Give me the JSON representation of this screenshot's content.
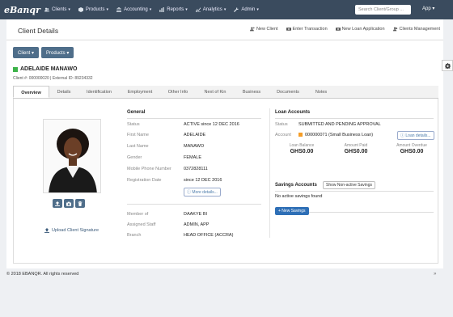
{
  "nav": {
    "brand": "eBanqr",
    "items": [
      {
        "label": "Clients",
        "icon": "users-icon"
      },
      {
        "label": "Products",
        "icon": "box-icon"
      },
      {
        "label": "Accounting",
        "icon": "bank-icon"
      },
      {
        "label": "Reports",
        "icon": "bar-chart-icon"
      },
      {
        "label": "Analytics",
        "icon": "line-chart-icon"
      },
      {
        "label": "Admin",
        "icon": "wrench-icon"
      }
    ],
    "search_placeholder": "Search Client/Group ...",
    "app_user": "App"
  },
  "header": {
    "title": "Client Details",
    "links": [
      {
        "label": "New Client",
        "icon": "user-plus-icon"
      },
      {
        "label": "Enter Transaction",
        "icon": "money-icon"
      },
      {
        "label": "New Loan Application",
        "icon": "money-icon"
      },
      {
        "label": "Clients Management",
        "icon": "users-icon"
      }
    ]
  },
  "toolbar": {
    "client_label": "Client",
    "products_label": "Products"
  },
  "client": {
    "name": "ADELAIDE MANAWO",
    "ids": "Client #: 000000020 | External ID: 89234332",
    "status_color": "#3db34a"
  },
  "tabs": [
    "Overview",
    "Details",
    "Identification",
    "Employment",
    "Other Info",
    "Next of Kin",
    "Business",
    "Documents",
    "Notes"
  ],
  "photo": {
    "upload_signature_label": "Upload Client Signature"
  },
  "general": {
    "title": "General",
    "rows": [
      {
        "label": "Status",
        "value": "ACTIVE since 12 DEC 2016"
      },
      {
        "label": "First Name",
        "value": "ADELAIDE"
      },
      {
        "label": "Last Name",
        "value": "MANAWO"
      },
      {
        "label": "Gender",
        "value": "FEMALE"
      },
      {
        "label": "Mobile Phone Number",
        "value": "0372828111"
      },
      {
        "label": "Registration Date",
        "value": "since 12 DEC 2016"
      }
    ],
    "more_details_label": "More details...",
    "rows2": [
      {
        "label": "Member of",
        "value": "DAAKYE BI"
      },
      {
        "label": "Assigned Staff",
        "value": "ADMIN, APP"
      },
      {
        "label": "Branch",
        "value": "HEAD OFFICE (ACCRA)"
      }
    ]
  },
  "loans": {
    "title": "Loan Accounts",
    "status_label": "Status",
    "status_value": "SUBMITTED AND PENDING APPROVAL",
    "account_label": "Account",
    "account_value": "000000071 (Small Business Loan)",
    "loan_details_label": "Loan details...",
    "metrics": [
      {
        "label": "Loan Balance",
        "value": "GHS0.00"
      },
      {
        "label": "Amount Paid",
        "value": "GHS0.00"
      },
      {
        "label": "Amount Overdue",
        "value": "GHS0.00"
      }
    ]
  },
  "savings": {
    "title": "Savings Accounts",
    "toggle_label": "Show Non-active Savings",
    "empty_text": "No active savings found",
    "new_label": "+ New Savings"
  },
  "footer": {
    "text": "© 2018 EBANQR. All rights reserved"
  }
}
